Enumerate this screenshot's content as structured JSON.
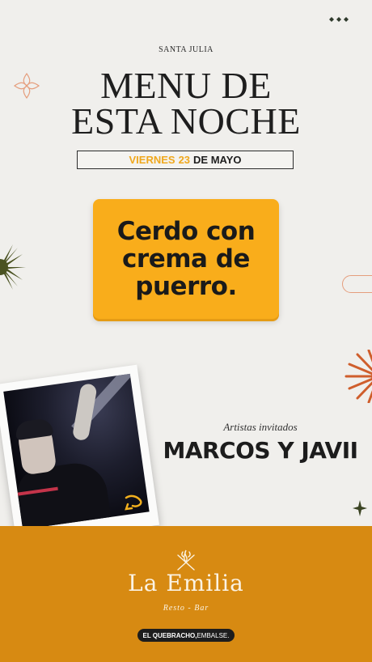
{
  "header": {
    "brand": "SANTA JULIA",
    "title_line1": "MENU DE",
    "title_line2": "ESTA NOCHE"
  },
  "date": {
    "weekday": "VIERNES",
    "day": "23",
    "month": "DE MAYO"
  },
  "dish": {
    "line1": "Cerdo con",
    "line2": "crema de",
    "line3": "puerro."
  },
  "artists": {
    "label": "Artistas invitados",
    "name": "MARCOS Y JAVII"
  },
  "footer": {
    "logo_name": "La Emilia",
    "logo_sub": "Resto - Bar",
    "location_bold": "EL QUEBRACHO,",
    "location_light": "EMBALSE."
  },
  "colors": {
    "accent": "#f9ad1b",
    "band": "#d78a12",
    "dark": "#1d1d1d",
    "background": "#f0efec"
  },
  "icons": [
    "three-dots-icon",
    "flower-outline-icon",
    "sun-burst-icon",
    "pill-outline-icon",
    "fan-burst-icon",
    "diamond-star-icon",
    "fire-utensils-icon",
    "scribble-icon"
  ]
}
